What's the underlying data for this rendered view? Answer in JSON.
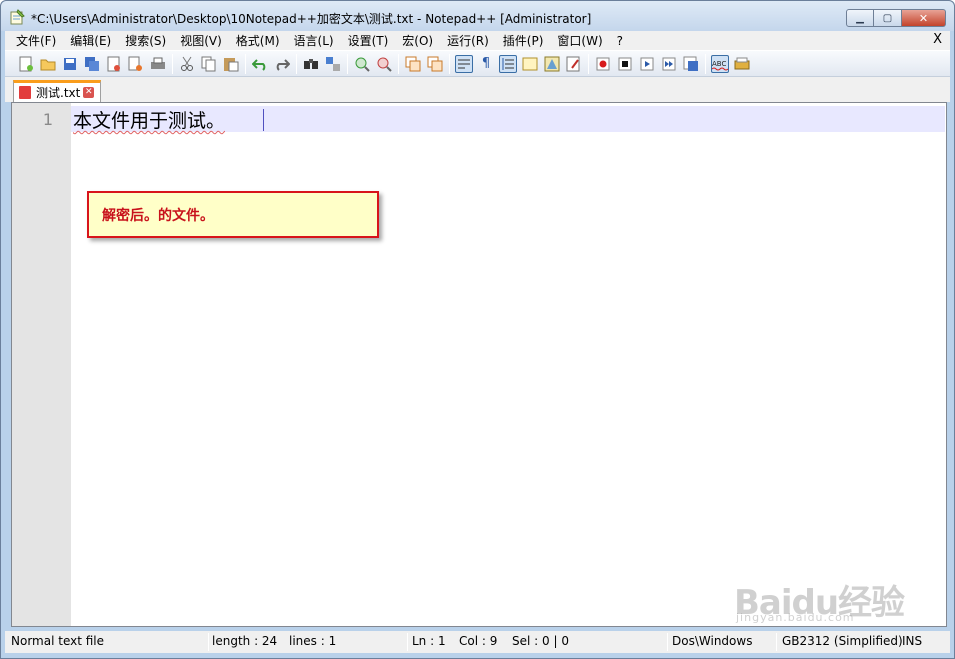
{
  "window": {
    "title": "*C:\\Users\\Administrator\\Desktop\\10Notepad++加密文本\\测试.txt - Notepad++ [Administrator]",
    "controls": {
      "minimize": "▁",
      "maximize": "▢",
      "close": "✕"
    }
  },
  "menu": {
    "items": [
      "文件(F)",
      "编辑(E)",
      "搜索(S)",
      "视图(V)",
      "格式(M)",
      "语言(L)",
      "设置(T)",
      "宏(O)",
      "运行(R)",
      "插件(P)",
      "窗口(W)",
      "?"
    ],
    "close_label": "X"
  },
  "toolbar": {
    "icons": [
      "new-icon",
      "open-icon",
      "save-icon",
      "save-all-icon",
      "close-icon",
      "close-all-icon",
      "print-icon",
      "cut-icon",
      "copy-icon",
      "paste-icon",
      "undo-icon",
      "redo-icon",
      "find-icon",
      "replace-icon",
      "zoom-in-icon",
      "zoom-out-icon",
      "sync-vertical-icon",
      "sync-horizontal-icon",
      "word-wrap-icon",
      "show-all-chars-icon",
      "indent-guide-icon",
      "user-language-icon",
      "doc-map-icon",
      "function-list-icon",
      "record-macro-icon",
      "stop-record-icon",
      "playback-macro-icon",
      "run-macro-multiple-icon",
      "save-macro-icon",
      "spell-check-icon",
      "spell-check-auto-icon"
    ]
  },
  "tab": {
    "label": "测试.txt",
    "close": "✕"
  },
  "editor": {
    "line_number": "1",
    "line_text": "本文件用于测试。"
  },
  "callout": {
    "text": "解密后。的文件。"
  },
  "status": {
    "file_type": "Normal text file",
    "length": "length : 24",
    "lines": "lines : 1",
    "ln": "Ln : 1",
    "col": "Col : 9",
    "sel": "Sel : 0 | 0",
    "eol": "Dos\\Windows",
    "encoding": "GB2312 (Simplified)",
    "mode": "INS"
  },
  "watermark": {
    "main": "Baidu经验",
    "sub": "jingyan.baidu.com"
  }
}
